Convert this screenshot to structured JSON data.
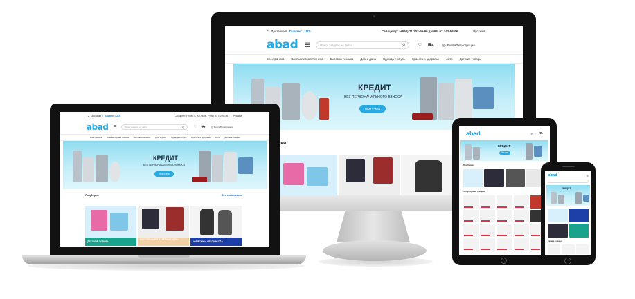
{
  "site": {
    "delivery_prefix": "Доставка в",
    "delivery_city": "Ташкент | UZS",
    "callcenter": "Call-центр: (+998) 71 202-96-96, (+998) 97 742-96-96",
    "language": "Русский",
    "logo": "abad",
    "search_placeholder": "Поиск товаров на сайте",
    "login": "Войти/Регистрация",
    "nav": [
      "Электроника",
      "Компьютерная техника",
      "Бытовая техника",
      "Дом и дача",
      "Одежда и обувь",
      "Красота и здоровье",
      "Авто",
      "Детские товары"
    ],
    "hero": {
      "title": "КРЕДИТ",
      "subtitle": "БЕЗ ПЕРВОНАЧАЛЬНОГО ВЗНОСА",
      "button": "Мои счета"
    },
    "collections": {
      "title": "Подборки",
      "link": "Все коллекции",
      "imac_title_fragment": "орки",
      "cards": [
        {
          "label": "ДЕТСКИЕ ТОВАРЫ",
          "color": "#1aa38c"
        },
        {
          "label": "НАСТОЛЬНЫЕ И АЗАРТНЫЕ ИГРЫ",
          "color": "#f2d2a5"
        },
        {
          "label": "КОЛЯСКИ И АВТОКРЕСЛА",
          "color": "#1d3fa8"
        }
      ]
    },
    "tablet_sections": [
      "Подборки",
      "Популярные товары"
    ],
    "phone_section": "Скидки и акции"
  },
  "colors": {
    "brand": "#29a9e1",
    "hero_bg": "#bfeaf7",
    "price_red": "#d9364a"
  },
  "icons": [
    "location-pin-icon",
    "menu-icon",
    "search-icon",
    "heart-icon",
    "cart-icon",
    "user-icon",
    "apple-logo-icon"
  ]
}
